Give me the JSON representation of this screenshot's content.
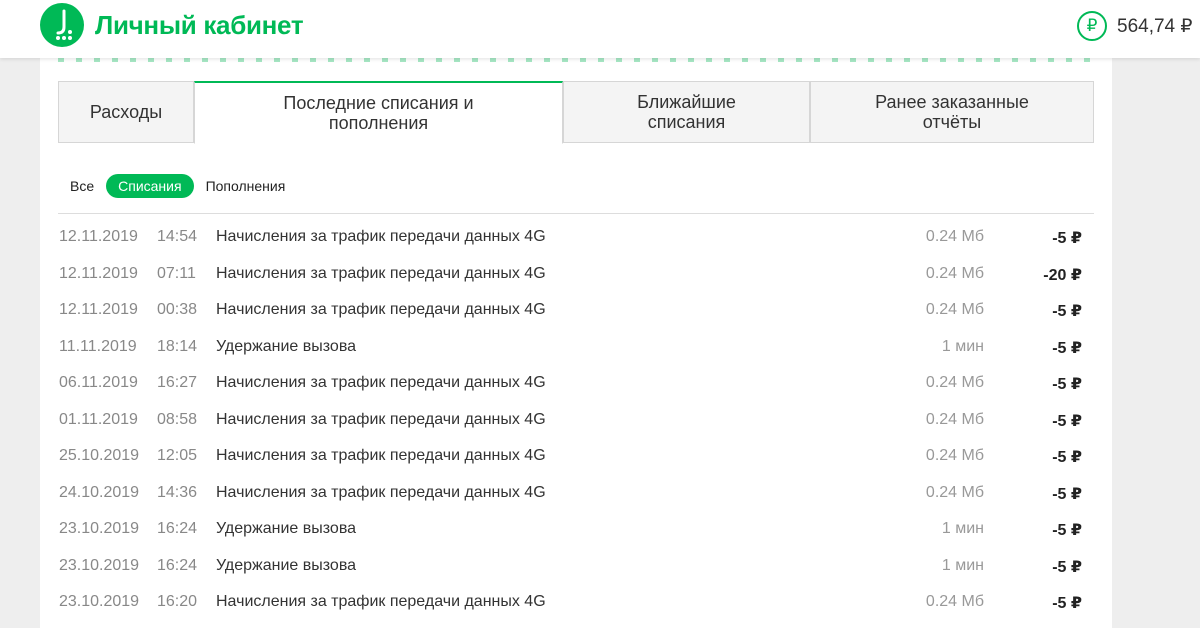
{
  "header": {
    "title": "Личный кабинет",
    "logo_icon": "megafon-logo-icon",
    "balance_symbol": "₽",
    "balance": "564,74 ₽"
  },
  "tabs": [
    {
      "line1": "Расходы",
      "line2": ""
    },
    {
      "line1": "Последние списания и",
      "line2": "пополнения"
    },
    {
      "line1": "Ближайшие",
      "line2": "списания"
    },
    {
      "line1": "Ранее заказанные",
      "line2": "отчёты"
    }
  ],
  "filters": [
    "Все",
    "Списания",
    "Пополнения"
  ],
  "rows": [
    {
      "date": "12.11.2019",
      "time": "14:54",
      "desc": "Начисления за трафик передачи данных 4G",
      "volume": "0.24 Мб",
      "amount": "-5 ₽"
    },
    {
      "date": "12.11.2019",
      "time": "07:11",
      "desc": "Начисления за трафик передачи данных 4G",
      "volume": "0.24 Мб",
      "amount": "-20 ₽"
    },
    {
      "date": "12.11.2019",
      "time": "00:38",
      "desc": "Начисления за трафик передачи данных 4G",
      "volume": "0.24 Мб",
      "amount": "-5 ₽"
    },
    {
      "date": "11.11.2019",
      "time": "18:14",
      "desc": "Удержание вызова",
      "volume": "1 мин",
      "amount": "-5 ₽"
    },
    {
      "date": "06.11.2019",
      "time": "16:27",
      "desc": "Начисления за трафик передачи данных 4G",
      "volume": "0.24 Мб",
      "amount": "-5 ₽"
    },
    {
      "date": "01.11.2019",
      "time": "08:58",
      "desc": "Начисления за трафик передачи данных 4G",
      "volume": "0.24 Мб",
      "amount": "-5 ₽"
    },
    {
      "date": "25.10.2019",
      "time": "12:05",
      "desc": "Начисления за трафик передачи данных 4G",
      "volume": "0.24 Мб",
      "amount": "-5 ₽"
    },
    {
      "date": "24.10.2019",
      "time": "14:36",
      "desc": "Начисления за трафик передачи данных 4G",
      "volume": "0.24 Мб",
      "amount": "-5 ₽"
    },
    {
      "date": "23.10.2019",
      "time": "16:24",
      "desc": "Удержание вызова",
      "volume": "1 мин",
      "amount": "-5 ₽"
    },
    {
      "date": "23.10.2019",
      "time": "16:24",
      "desc": "Удержание вызова",
      "volume": "1 мин",
      "amount": "-5 ₽"
    },
    {
      "date": "23.10.2019",
      "time": "16:20",
      "desc": "Начисления за трафик передачи данных 4G",
      "volume": "0.24 Мб",
      "amount": "-5 ₽"
    }
  ],
  "colors": {
    "accent": "#00b956",
    "text": "#333333",
    "muted": "#888888"
  }
}
